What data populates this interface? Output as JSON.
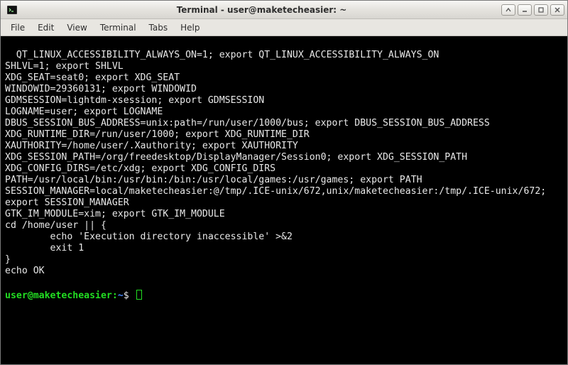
{
  "window": {
    "title": "Terminal - user@maketecheasier: ~"
  },
  "menubar": {
    "items": [
      "File",
      "Edit",
      "View",
      "Terminal",
      "Tabs",
      "Help"
    ]
  },
  "terminal": {
    "lines": [
      "QT_LINUX_ACCESSIBILITY_ALWAYS_ON=1; export QT_LINUX_ACCESSIBILITY_ALWAYS_ON",
      "SHLVL=1; export SHLVL",
      "XDG_SEAT=seat0; export XDG_SEAT",
      "WINDOWID=29360131; export WINDOWID",
      "GDMSESSION=lightdm-xsession; export GDMSESSION",
      "LOGNAME=user; export LOGNAME",
      "DBUS_SESSION_BUS_ADDRESS=unix:path=/run/user/1000/bus; export DBUS_SESSION_BUS_ADDRESS",
      "XDG_RUNTIME_DIR=/run/user/1000; export XDG_RUNTIME_DIR",
      "XAUTHORITY=/home/user/.Xauthority; export XAUTHORITY",
      "XDG_SESSION_PATH=/org/freedesktop/DisplayManager/Session0; export XDG_SESSION_PATH",
      "XDG_CONFIG_DIRS=/etc/xdg; export XDG_CONFIG_DIRS",
      "PATH=/usr/local/bin:/usr/bin:/bin:/usr/local/games:/usr/games; export PATH",
      "SESSION_MANAGER=local/maketecheasier:@/tmp/.ICE-unix/672,unix/maketecheasier:/tmp/.ICE-unix/672; export SESSION_MANAGER",
      "GTK_IM_MODULE=xim; export GTK_IM_MODULE",
      "cd /home/user || {",
      "        echo 'Execution directory inaccessible' >&2",
      "        exit 1",
      "}",
      "echo OK",
      ""
    ],
    "prompt": {
      "user_host": "user@maketecheasier",
      "separator": ":",
      "path": "~",
      "char": "$"
    },
    "wrap_cols": 97
  }
}
